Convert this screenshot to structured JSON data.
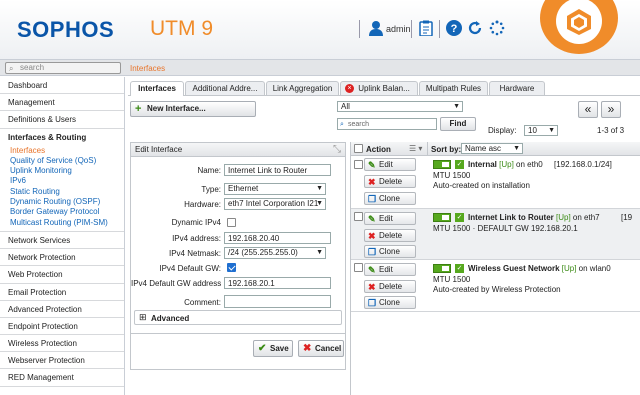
{
  "header": {
    "logo": "SOPHOS",
    "product": "UTM 9",
    "user": "admin",
    "icons": [
      "user-icon",
      "clipboard-icon",
      "help-icon",
      "reload-icon",
      "spinner-icon"
    ]
  },
  "search": {
    "placeholder": "search"
  },
  "breadcrumb": "Interfaces",
  "nav": {
    "top": [
      "Dashboard",
      "Management",
      "Definitions & Users"
    ],
    "group": {
      "title": "Interfaces & Routing",
      "items": [
        "Interfaces",
        "Quality of Service (QoS)",
        "Uplink Monitoring",
        "IPv6",
        "Static Routing",
        "Dynamic Routing (OSPF)",
        "Border Gateway Protocol",
        "Multicast Routing (PIM-SM)"
      ],
      "active": "Interfaces"
    },
    "bottom": [
      "Network Services",
      "Network Protection",
      "Web Protection",
      "Email Protection",
      "Advanced Protection",
      "Endpoint Protection",
      "Wireless Protection",
      "Webserver Protection",
      "RED Management"
    ]
  },
  "tabs": [
    "Interfaces",
    "Additional Addre...",
    "Link Aggregation",
    "Uplink Balan...",
    "Multipath Rules",
    "Hardware"
  ],
  "toolbar": {
    "new_interface": "New Interface...",
    "filter_value": "All",
    "search_placeholder": "search",
    "find": "Find",
    "display_label": "Display:",
    "display_value": "10",
    "pager": "1-3 of 3",
    "prev": "«",
    "next": "»"
  },
  "edit": {
    "title": "Edit Interface",
    "name_label": "Name:",
    "name": "Internet Link to Router",
    "type_label": "Type:",
    "type": "Ethernet",
    "hardware_label": "Hardware:",
    "hardware": "eth7 Intel Corporation I21",
    "dyn_label": "Dynamic IPv4",
    "addr_label": "IPv4 address:",
    "addr": "192.168.20.40",
    "mask_label": "IPv4 Netmask:",
    "mask": "/24 (255.255.255.0)",
    "gw_label": "IPv4 Default GW:",
    "gwaddr_label": "IPv4 Default GW address",
    "gwaddr": "192.168.20.1",
    "comment_label": "Comment:",
    "comment": "",
    "advanced": "Advanced",
    "save": "Save",
    "cancel": "Cancel"
  },
  "list": {
    "action_header": "Action",
    "sort_label": "Sort by:",
    "sort_value": "Name asc",
    "edit_label": "Edit",
    "delete_label": "Delete",
    "clone_label": "Clone",
    "rows": [
      {
        "name": "Internal",
        "status": "[Up]",
        "iface": "on eth0",
        "addr": "[192.168.0.1/24]",
        "line2": "MTU 1500",
        "line3": "Auto-created on installation"
      },
      {
        "name": "Internet Link to Router",
        "status": "[Up]",
        "iface": "on eth7",
        "addr": "[19",
        "line2": "MTU 1500 · DEFAULT GW 192.168.20.1",
        "line3": ""
      },
      {
        "name": "Wireless Guest Network",
        "status": "[Up]",
        "iface": "on wlan0",
        "addr": "",
        "line2": "MTU 1500",
        "line3": "Auto-created by Wireless Protection"
      }
    ]
  },
  "colors": {
    "brand": "#0a55a8",
    "accent": "#f08c2a",
    "link": "#1366b8",
    "ok": "#56a81e",
    "danger": "#d22"
  }
}
